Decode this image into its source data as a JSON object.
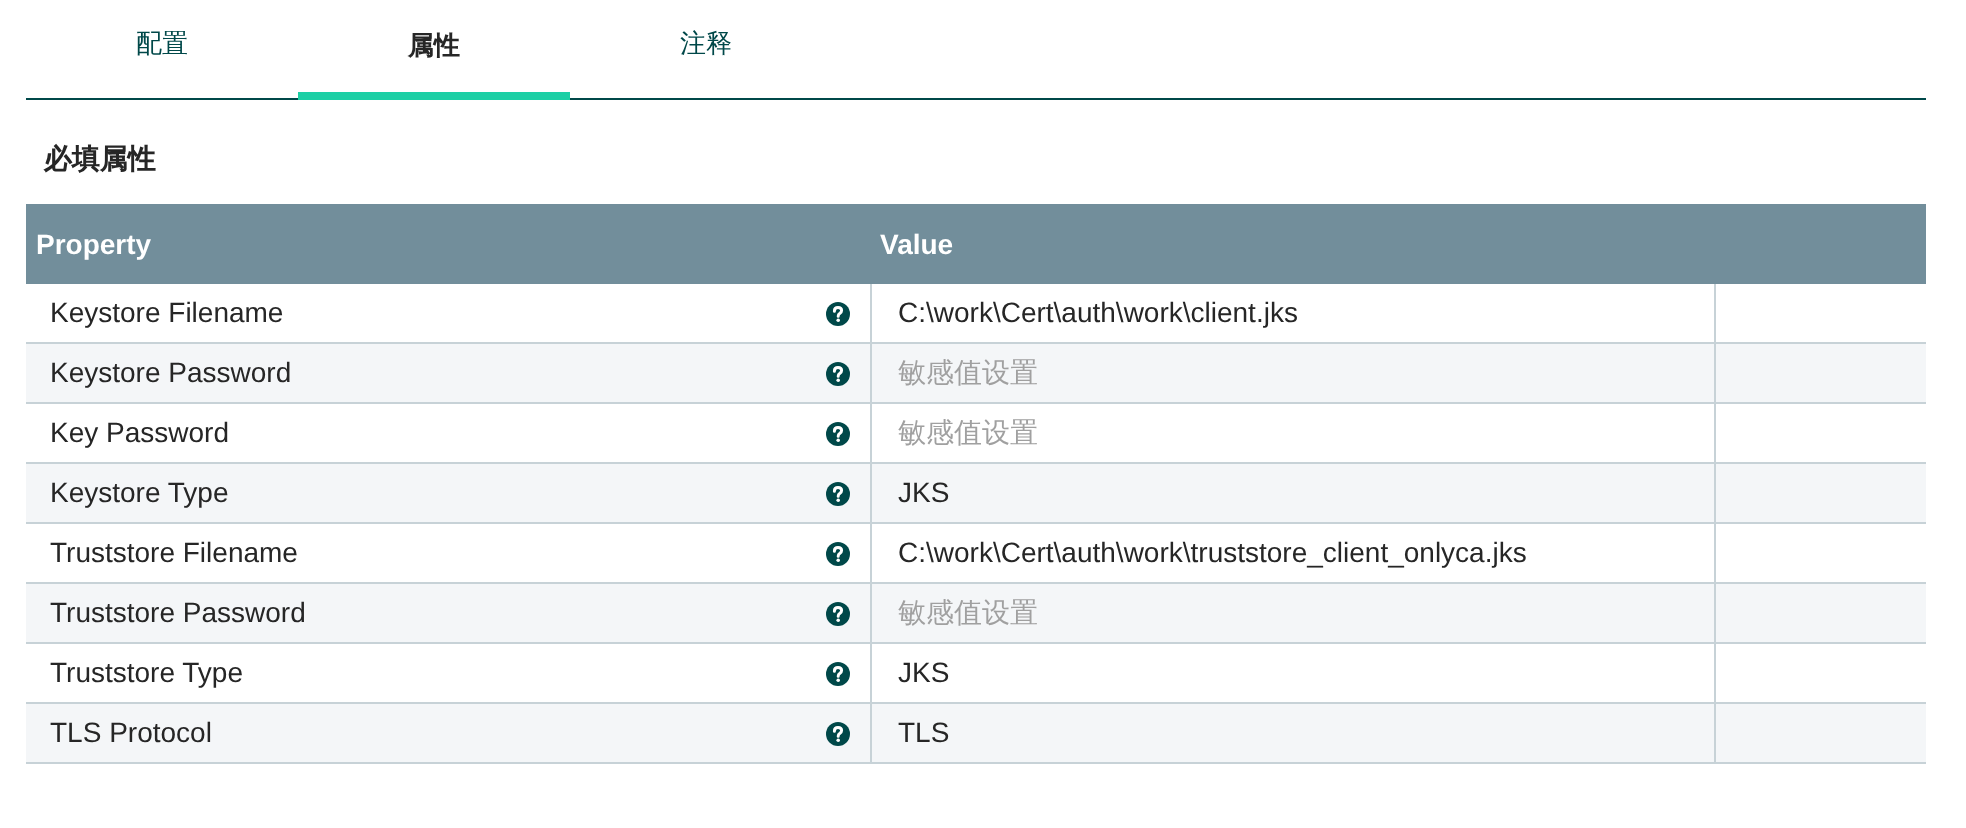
{
  "tabs": [
    {
      "label": "配置",
      "selected": false
    },
    {
      "label": "属性",
      "selected": true
    },
    {
      "label": "注释",
      "selected": false
    }
  ],
  "section_title": "必填属性",
  "table": {
    "columns": [
      "Property",
      "Value"
    ],
    "rows": [
      {
        "property": "Keystore Filename",
        "value": "C:\\work\\Cert\\auth\\work\\client.jks",
        "sensitive": false
      },
      {
        "property": "Keystore Password",
        "value": "敏感值设置",
        "sensitive": true
      },
      {
        "property": "Key Password",
        "value": "敏感值设置",
        "sensitive": true
      },
      {
        "property": "Keystore Type",
        "value": "JKS",
        "sensitive": false
      },
      {
        "property": "Truststore Filename",
        "value": "C:\\work\\Cert\\auth\\work\\truststore_client_onlyca.jks",
        "sensitive": false
      },
      {
        "property": "Truststore Password",
        "value": "敏感值设置",
        "sensitive": true
      },
      {
        "property": "Truststore Type",
        "value": "JKS",
        "sensitive": false
      },
      {
        "property": "TLS Protocol",
        "value": "TLS",
        "sensitive": false
      }
    ]
  }
}
